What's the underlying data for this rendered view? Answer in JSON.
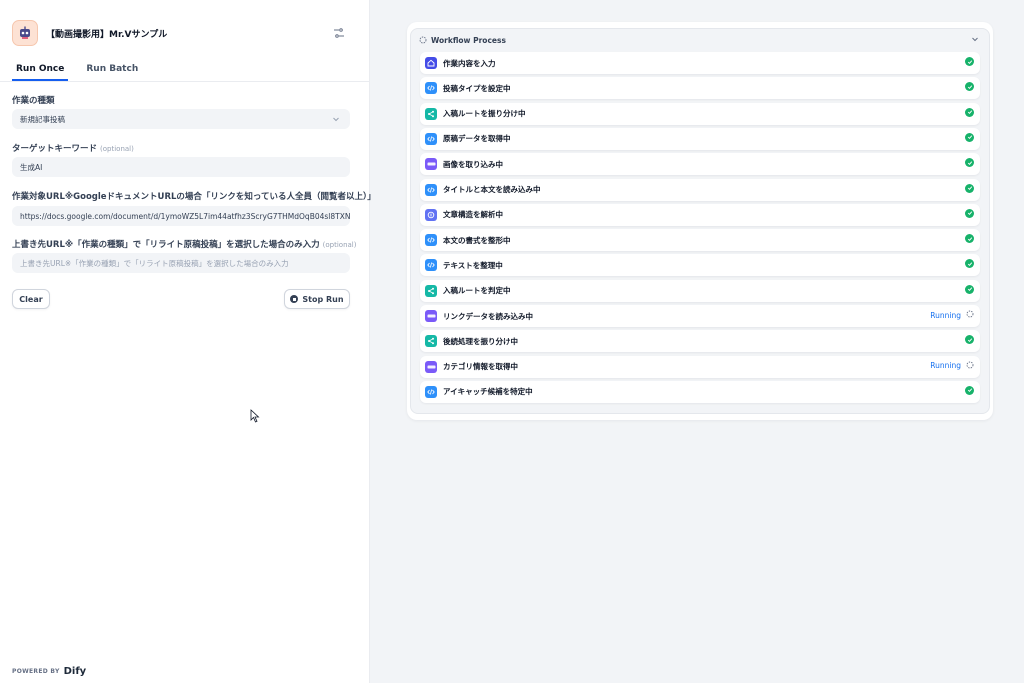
{
  "app": {
    "title": "【動画撮影用】Mr.Vサンプル",
    "icon": "robot-icon"
  },
  "tabs": [
    {
      "label": "Run Once",
      "active": true
    },
    {
      "label": "Run Batch",
      "active": false
    }
  ],
  "fields": {
    "type": {
      "label": "作業の種類",
      "value": "新規記事投稿"
    },
    "keyword": {
      "label": "ターゲットキーワード",
      "optional": "(optional)",
      "value": "生成AI"
    },
    "source_url": {
      "label": "作業対象URL※GoogleドキュメントURLの場合「リンクを知っている人全員（閲覧者以上）」",
      "value": "https://docs.google.com/document/d/1ymoWZ5L7im44atfhz3ScryG7THMdOqB04sl8TXN"
    },
    "overwrite_url": {
      "label": "上書き先URL※「作業の種類」で「リライト原稿投稿」を選択した場合のみ入力",
      "optional": "(optional)",
      "placeholder": "上書き先URL※「作業の種類」で「リライト原稿投稿」を選択した場合のみ入力"
    }
  },
  "buttons": {
    "clear": "Clear",
    "stop": "Stop Run"
  },
  "footer": {
    "powered_by": "POWERED BY",
    "brand": "Dify"
  },
  "workflow": {
    "title": "Workflow Process",
    "running_label": "Running",
    "colors": {
      "blue": "#2e90fa",
      "teal": "#15b8a6",
      "purple": "#7a5af8",
      "indigo": "#444ce7",
      "success": "#17b26a"
    },
    "nodes": [
      {
        "name": "作業内容を入力",
        "kind": "start",
        "color": "#444ce7",
        "status": "done"
      },
      {
        "name": "投稿タイプを設定中",
        "kind": "code",
        "color": "#2e90fa",
        "status": "done"
      },
      {
        "name": "入稿ルートを振り分け中",
        "kind": "branch",
        "color": "#15b8a6",
        "status": "done"
      },
      {
        "name": "原稿データを取得中",
        "kind": "code",
        "color": "#2e90fa",
        "status": "done"
      },
      {
        "name": "画像を取り込み中",
        "kind": "api",
        "color": "#7a5af8",
        "status": "done"
      },
      {
        "name": "タイトルと本文を読み込み中",
        "kind": "code",
        "color": "#2e90fa",
        "status": "done"
      },
      {
        "name": "文章構造を解析中",
        "kind": "llm",
        "color": "#6172f3",
        "status": "done"
      },
      {
        "name": "本文の書式を整形中",
        "kind": "code",
        "color": "#2e90fa",
        "status": "done"
      },
      {
        "name": "テキストを整理中",
        "kind": "code",
        "color": "#2e90fa",
        "status": "done"
      },
      {
        "name": "入稿ルートを判定中",
        "kind": "branch",
        "color": "#15b8a6",
        "status": "done"
      },
      {
        "name": "リンクデータを読み込み中",
        "kind": "api",
        "color": "#7a5af8",
        "status": "running"
      },
      {
        "name": "後続処理を振り分け中",
        "kind": "branch",
        "color": "#15b8a6",
        "status": "done"
      },
      {
        "name": "カテゴリ情報を取得中",
        "kind": "api",
        "color": "#7a5af8",
        "status": "running"
      },
      {
        "name": "アイキャッチ候補を特定中",
        "kind": "code",
        "color": "#2e90fa",
        "status": "done"
      }
    ]
  }
}
